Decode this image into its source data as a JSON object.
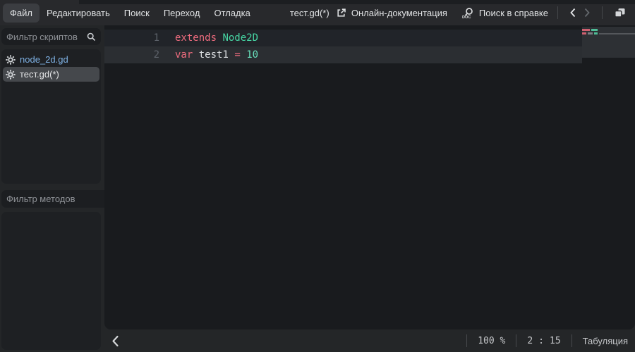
{
  "menubar": {
    "menus": [
      {
        "id": "file",
        "label": "Файл",
        "active": true
      },
      {
        "id": "edit",
        "label": "Редактировать",
        "active": false
      },
      {
        "id": "search",
        "label": "Поиск",
        "active": false
      },
      {
        "id": "goto",
        "label": "Переход",
        "active": false
      },
      {
        "id": "debug",
        "label": "Отладка",
        "active": false
      }
    ],
    "current_script": "тест.gd(*)",
    "online_docs_label": "Онлайн-документация",
    "search_help_label": "Поиск в справке"
  },
  "sidebar": {
    "scripts_filter_placeholder": "Фильтр скриптов",
    "methods_filter_placeholder": "Фильтр методов",
    "scripts": [
      {
        "label": "node_2d.gd",
        "selected": false,
        "color": "#7fb2e5"
      },
      {
        "label": "тест.gd(*)",
        "selected": true,
        "color": "#e3e4e6"
      }
    ]
  },
  "editor": {
    "lines": [
      {
        "number": "1",
        "current": false,
        "tokens": [
          {
            "text": "extends",
            "cls": "keyword"
          },
          {
            "text": " ",
            "cls": "plain"
          },
          {
            "text": "Node2D",
            "cls": "type"
          }
        ]
      },
      {
        "number": "2",
        "current": true,
        "tokens": [
          {
            "text": "var",
            "cls": "keyword"
          },
          {
            "text": " ",
            "cls": "plain"
          },
          {
            "text": "test1",
            "cls": "plain"
          },
          {
            "text": " ",
            "cls": "plain"
          },
          {
            "text": "=",
            "cls": "operator"
          },
          {
            "text": " ",
            "cls": "plain"
          },
          {
            "text": "10",
            "cls": "number"
          }
        ]
      }
    ],
    "minimap": {
      "rows": [
        {
          "segments": [
            {
              "w": 11,
              "cls": "keyword"
            },
            {
              "w": 9,
              "cls": "type"
            }
          ]
        },
        {
          "segments": [
            {
              "w": 6,
              "cls": "keyword"
            },
            {
              "w": 7,
              "cls": "plain"
            },
            {
              "w": 5,
              "cls": "type"
            },
            {
              "w": "fill",
              "cls": "fill"
            }
          ]
        }
      ]
    }
  },
  "statusbar": {
    "zoom": "100 %",
    "caret_line": "2",
    "caret_separator": ":",
    "caret_column": "15",
    "indent_type": "Табуляция"
  },
  "colors": {
    "keyword": "#ee6c7e",
    "base_type": "#47d6a4",
    "number": "#69e2bd",
    "text": "#dde0e3",
    "script_name_blue": "#7fb2e5",
    "selected_item_bg": "#45484c",
    "current_line_bg": "#2b2e32",
    "editor_bg": "#191b1e",
    "chrome_bg": "#242628",
    "menubar_bg": "#28292c"
  }
}
